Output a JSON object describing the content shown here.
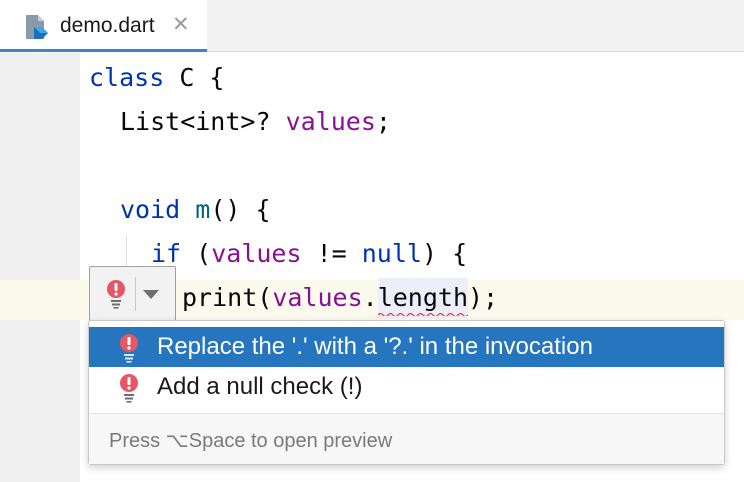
{
  "tab": {
    "title": "demo.dart",
    "close_glyph": "✕",
    "icon": "dart-file-icon"
  },
  "code": {
    "line1": {
      "kw": "class",
      "rest": " C {"
    },
    "line2": {
      "type": "List<int>?",
      "space": " ",
      "field": "values",
      "end": ";"
    },
    "line3": {
      "kw": "void",
      "space": " ",
      "fn": "m",
      "rest": "() {"
    },
    "line4": {
      "kw": "if",
      "open": " (",
      "field": "values",
      "op": " != ",
      "kw2": "null",
      "close": ") {"
    },
    "line5": {
      "pre": "print(",
      "field": "values",
      "dot": ".",
      "prop": "length",
      "post": ");"
    }
  },
  "intention_button": {
    "icon": "error-bulb-icon",
    "arrow_icon": "dropdown-arrow-icon"
  },
  "popup": {
    "items": [
      {
        "label": "Replace the '.' with a '?.' in the invocation",
        "icon": "error-bulb-icon",
        "selected": true
      },
      {
        "label": "Add a null check (!)",
        "icon": "error-bulb-icon",
        "selected": false
      }
    ],
    "footer_hint": "Press ⌥Space to open preview"
  },
  "colors": {
    "keyword": "#0033b3",
    "field": "#871094",
    "function": "#00627a",
    "selection": "#2675bf",
    "error_bulb": "#e55765"
  }
}
